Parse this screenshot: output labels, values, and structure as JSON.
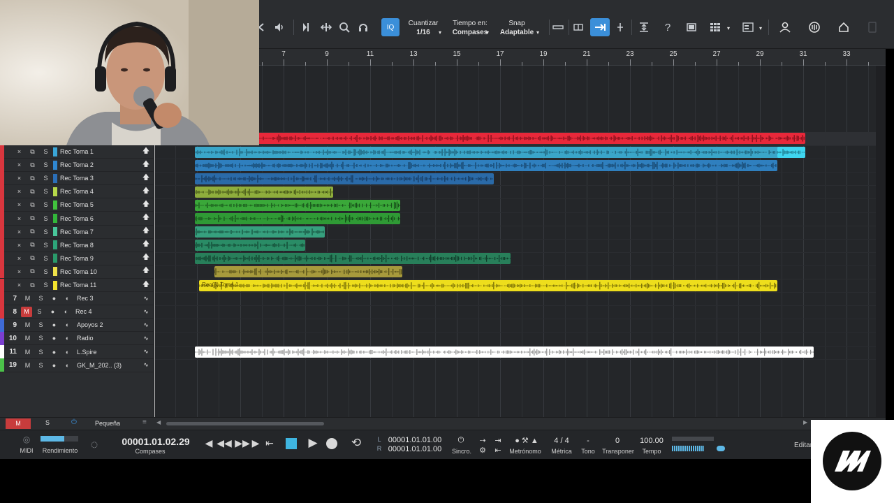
{
  "toolbar": {
    "iq_label": "IQ",
    "quantize": {
      "label": "Cuantizar",
      "value": "1/16"
    },
    "timebase": {
      "label": "Tiempo en:",
      "value": "Compases"
    },
    "snap": {
      "label": "Snap",
      "value": "Adaptable"
    },
    "icons": [
      "rewind-partial-icon",
      "speaker-icon",
      "split-icon",
      "range-icon",
      "zoom-icon",
      "listen-icon",
      "clip-gain-icon",
      "fade-icon",
      "arrow-right-icon",
      "cursor-icon",
      "align-icon",
      "help-icon",
      "film-icon",
      "grid-icon",
      "layout-icon",
      "user-icon",
      "audio-icon",
      "home-icon",
      "blank-icon"
    ]
  },
  "ruler": {
    "bars": [
      "7",
      "9",
      "11",
      "13",
      "15",
      "17",
      "19",
      "21",
      "23",
      "25",
      "27",
      "29",
      "31",
      "33"
    ]
  },
  "tracks": [
    {
      "type": "take",
      "name": "Rec Toma 1",
      "color": "#3aa6d8",
      "mute": "×",
      "copy": "⧉",
      "solo": "S"
    },
    {
      "type": "take",
      "name": "Rec Toma 2",
      "color": "#2f87d1",
      "mute": "×",
      "copy": "⧉",
      "solo": "S"
    },
    {
      "type": "take",
      "name": "Rec Toma 3",
      "color": "#2b6fb8",
      "mute": "×",
      "copy": "⧉",
      "solo": "S"
    },
    {
      "type": "take",
      "name": "Rec Toma 4",
      "color": "#b6d84a",
      "mute": "×",
      "copy": "⧉",
      "solo": "S"
    },
    {
      "type": "take",
      "name": "Rec Toma 5",
      "color": "#41c23d",
      "mute": "×",
      "copy": "⧉",
      "solo": "S"
    },
    {
      "type": "take",
      "name": "Rec Toma 6",
      "color": "#32b63a",
      "mute": "×",
      "copy": "⧉",
      "solo": "S"
    },
    {
      "type": "take",
      "name": "Rec Toma 7",
      "color": "#49c79b",
      "mute": "×",
      "copy": "⧉",
      "solo": "S"
    },
    {
      "type": "take",
      "name": "Rec Toma 8",
      "color": "#2da57a",
      "mute": "×",
      "copy": "⧉",
      "solo": "S"
    },
    {
      "type": "take",
      "name": "Rec Toma 9",
      "color": "#2a9a6a",
      "mute": "×",
      "copy": "⧉",
      "solo": "S"
    },
    {
      "type": "take",
      "name": "Rec Toma 10",
      "color": "#efe24a",
      "mute": "×",
      "copy": "⧉",
      "solo": "S"
    },
    {
      "type": "take",
      "name": "Rec Toma 11",
      "color": "#f3e32e",
      "mute": "×",
      "copy": "⧉",
      "solo": "S"
    },
    {
      "type": "track",
      "num": "7",
      "name": "Rec 3",
      "color": "#d9363e",
      "m": "M",
      "s": "S",
      "m_active": false
    },
    {
      "type": "track",
      "num": "8",
      "name": "Rec 4",
      "color": "#d9363e",
      "m": "M",
      "s": "S",
      "m_active": true
    },
    {
      "type": "track",
      "num": "9",
      "name": "Apoyos 2",
      "color": "#3f6bd6",
      "m": "M",
      "s": "S",
      "m_active": false
    },
    {
      "type": "track",
      "num": "10",
      "name": "Radio",
      "color": "#7b3fd0",
      "m": "M",
      "s": "S",
      "m_active": false
    },
    {
      "type": "track",
      "num": "11",
      "name": "L.Spire",
      "color": "#ffffff",
      "m": "M",
      "s": "S",
      "m_active": false
    },
    {
      "type": "track",
      "num": "19",
      "name": "GK_M_202.. (3)",
      "color": "#4cc24a",
      "m": "M",
      "s": "S",
      "m_active": false
    }
  ],
  "clips": [
    {
      "row": -1,
      "bar_start": 2.9,
      "bar_end": 31.1,
      "color": "#e8283a",
      "wave": "#7a0d18"
    },
    {
      "row": 0,
      "bar_start": 2.9,
      "bar_end": 31.1,
      "color": "#3aa6c9",
      "wave": "#1c5a70"
    },
    {
      "row": 1,
      "bar_start": 2.9,
      "bar_end": 29.8,
      "color": "#2f7fbe",
      "wave": "#153f63"
    },
    {
      "row": 2,
      "bar_start": 2.9,
      "bar_end": 16.7,
      "color": "#2a6aa8",
      "wave": "#143659"
    },
    {
      "row": 3,
      "bar_start": 2.9,
      "bar_end": 9.3,
      "color": "#8fae3c",
      "wave": "#3e4f14"
    },
    {
      "row": 4,
      "bar_start": 2.9,
      "bar_end": 12.4,
      "color": "#3aa839",
      "wave": "#17501a"
    },
    {
      "row": 5,
      "bar_start": 2.9,
      "bar_end": 12.4,
      "color": "#2f9a35",
      "wave": "#144a17"
    },
    {
      "row": 6,
      "bar_start": 2.9,
      "bar_end": 8.9,
      "color": "#36a07e",
      "wave": "#164b3a"
    },
    {
      "row": 7,
      "bar_start": 2.9,
      "bar_end": 8.0,
      "color": "#2a8c66",
      "wave": "#11402e"
    },
    {
      "row": 8,
      "bar_start": 2.9,
      "bar_end": 17.5,
      "color": "#287f5a",
      "wave": "#0f3a29"
    },
    {
      "row": 9,
      "bar_start": 3.8,
      "bar_end": 12.5,
      "color": "#a79a3c",
      "wave": "#4d4714"
    },
    {
      "row": 10,
      "bar_start": 3.1,
      "bar_end": 29.8,
      "color": "#eede1c",
      "wave": "#6b6204",
      "label": "Rec(3) Toma 1"
    },
    {
      "row": 15,
      "bar_start": 2.9,
      "bar_end": 31.5,
      "color": "#ffffff",
      "wave": "#8a8a8a"
    }
  ],
  "cyan_tail": {
    "row": 0,
    "bar_start": 29.8,
    "bar_end": 31.1,
    "color": "#3fd6f0"
  },
  "bottombar": {
    "m": "M",
    "s": "S",
    "size": "Pequeña"
  },
  "transport": {
    "midi": "MIDI",
    "perf": "Rendimiento",
    "time": "00001.01.02.29",
    "time_unit": "Compases",
    "left_l": "L",
    "left_r": "R",
    "loop_start": "00001.01.01.00",
    "loop_end": "00001.01.01.00",
    "sync": "Sincro.",
    "metronome": "Metrónomo",
    "meter_value": "4 / 4",
    "meter": "Métrica",
    "key_value": "-",
    "key": "Tono",
    "transpose_value": "0",
    "transpose": "Transponer",
    "tempo_value": "100.00",
    "tempo": "Tempo",
    "edit": "Editar"
  },
  "logo": {
    "text": "LM"
  }
}
